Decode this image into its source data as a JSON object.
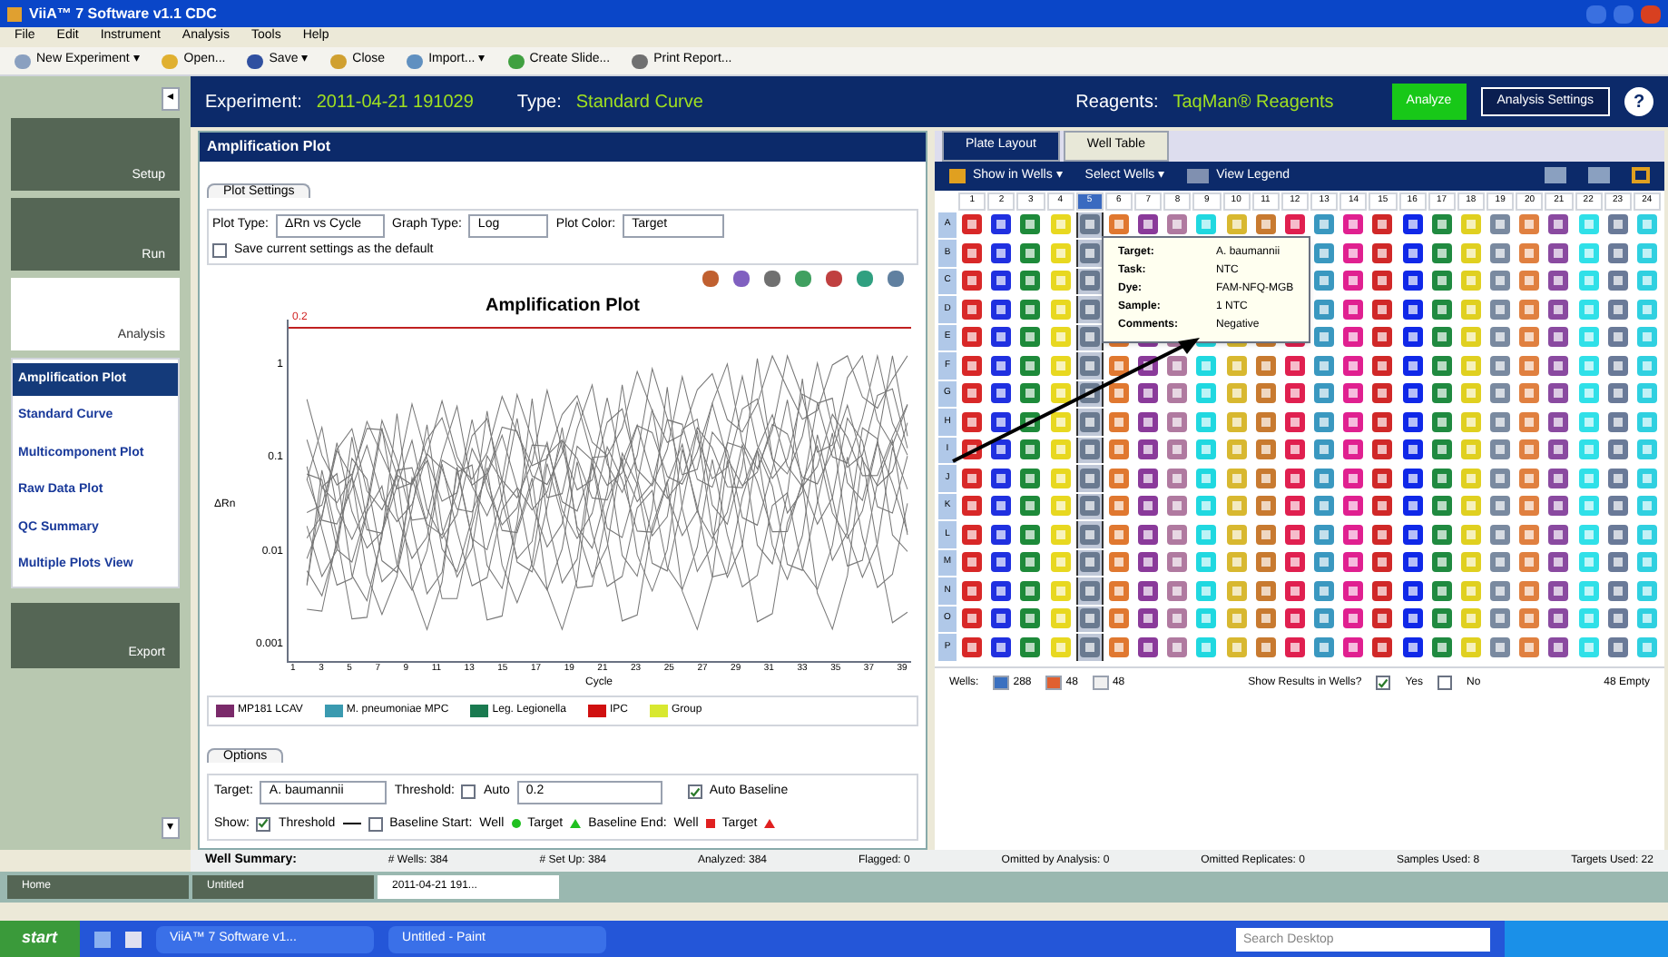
{
  "window": {
    "title": "ViiA™ 7 Software v1.1 CDC"
  },
  "menu": [
    "File",
    "Edit",
    "Instrument",
    "Analysis",
    "Tools",
    "Help"
  ],
  "toolbar": [
    {
      "label": "New Experiment ▾",
      "kind": "new"
    },
    {
      "label": "Open...",
      "kind": "open"
    },
    {
      "label": "Save ▾",
      "kind": "save"
    },
    {
      "label": "Close",
      "kind": "close"
    },
    {
      "label": "Import... ▾",
      "kind": "import"
    },
    {
      "label": "Create Slide...",
      "kind": "slide"
    },
    {
      "label": "Print Report...",
      "kind": "print"
    }
  ],
  "header": {
    "experiment_label": "Experiment:",
    "experiment": "2011-04-21 191029",
    "type_label": "Type:",
    "type": "Standard Curve",
    "reagents_label": "Reagents:",
    "reagents": "TaqMan® Reagents",
    "analyze": "Analyze",
    "settings": "Analysis Settings",
    "help": "?"
  },
  "sidebar": {
    "collapse": "◂",
    "sections": [
      {
        "label": "Setup",
        "kind": "setup"
      },
      {
        "label": "Run",
        "kind": "run"
      },
      {
        "label": "Analysis",
        "kind": "analysis"
      }
    ],
    "items": [
      {
        "label": "Amplification Plot",
        "selected": true
      },
      {
        "label": "Standard Curve",
        "selected": false
      },
      {
        "label": "Multicomponent Plot",
        "selected": false
      },
      {
        "label": "Raw Data Plot",
        "selected": false
      },
      {
        "label": "QC Summary",
        "selected": false
      },
      {
        "label": "Multiple Plots View",
        "selected": false
      }
    ],
    "export": "Export",
    "bottom_button": "▾"
  },
  "amplification": {
    "title": "Amplification Plot",
    "settings_tab": "Plot Settings",
    "plot_type_label": "Plot Type:",
    "plot_type": "ΔRn vs Cycle",
    "graph_type_label": "Graph Type:",
    "graph_type": "Log",
    "plot_color_label": "Plot Color:",
    "plot_color": "Target",
    "save_default": {
      "label": "Save current settings as the default",
      "checked": false
    },
    "chart": {
      "title": "Amplification Plot",
      "threshold": "0.2",
      "ylabel": "ΔRn",
      "xlabel": "Cycle",
      "y_tick_labels": [
        "1",
        "0.1",
        "0.01",
        "0.001"
      ],
      "x_tick_labels": [
        "1",
        "3",
        "5",
        "7",
        "9",
        "11",
        "13",
        "15",
        "17",
        "19",
        "21",
        "23",
        "25",
        "27",
        "29",
        "31",
        "33",
        "35",
        "37",
        "39"
      ]
    },
    "legend": [
      {
        "label": "MP181 LCAV",
        "color": "#7a2a6a"
      },
      {
        "label": "M. pneumoniae MPC",
        "color": "#3a9ab0"
      },
      {
        "label": "Leg. Legionella",
        "color": "#1a7a50"
      },
      {
        "label": "IPC",
        "color": "#d01010"
      },
      {
        "label": "Group",
        "color": "#d8e830"
      }
    ],
    "options_tab": "Options",
    "target_label": "Target:",
    "target": "A. baumannii",
    "threshold_label": "Threshold:",
    "auto_threshold": {
      "label": "Auto",
      "checked": false
    },
    "threshold": "0.2",
    "auto_baseline": {
      "label": "Auto Baseline",
      "checked": true
    },
    "show_label": "Show:",
    "show_threshold": {
      "label": "Threshold",
      "checked": true
    },
    "baseline_start": {
      "label": "Baseline Start:",
      "checked": false
    },
    "start_well": "Well",
    "start_target": "Target",
    "baseline_end": "Baseline End:",
    "end_well": "Well",
    "end_target": "Target"
  },
  "plate": {
    "tabs": [
      {
        "label": "Plate Layout",
        "selected": true
      },
      {
        "label": "Well Table",
        "selected": false
      }
    ],
    "show_in_wells": "Show in Wells ▾",
    "select_wells": "Select Wells ▾",
    "view_legend": "View Legend",
    "rows": [
      "A",
      "B",
      "C",
      "D",
      "E",
      "F",
      "G",
      "H",
      "I",
      "J",
      "K",
      "L",
      "M",
      "N",
      "O",
      "P"
    ],
    "columns": [
      {
        "label": "1",
        "color": "#d82828",
        "selected": false
      },
      {
        "label": "2",
        "color": "#2030e0",
        "selected": false
      },
      {
        "label": "3",
        "color": "#1e8a3a",
        "selected": false
      },
      {
        "label": "4",
        "color": "#e8d820",
        "selected": false
      },
      {
        "label": "5",
        "color": "#6a7a90",
        "selected": true
      },
      {
        "label": "6",
        "color": "#e07830",
        "selected": false
      },
      {
        "label": "7",
        "color": "#8a3a9a",
        "selected": false
      },
      {
        "label": "8",
        "color": "#b07aa0",
        "selected": false
      },
      {
        "label": "9",
        "color": "#20d8e0",
        "selected": false
      },
      {
        "label": "10",
        "color": "#d8b830",
        "selected": false
      },
      {
        "label": "11",
        "color": "#c87a30",
        "selected": false
      },
      {
        "label": "12",
        "color": "#e02050",
        "selected": false
      },
      {
        "label": "13",
        "color": "#3a98c0",
        "selected": false
      },
      {
        "label": "14",
        "color": "#e02090",
        "selected": false
      },
      {
        "label": "15",
        "color": "#d02828",
        "selected": false
      },
      {
        "label": "16",
        "color": "#1028e8",
        "selected": false
      },
      {
        "label": "17",
        "color": "#208a40",
        "selected": false
      },
      {
        "label": "18",
        "color": "#e0d020",
        "selected": false
      },
      {
        "label": "19",
        "color": "#7a8aa0",
        "selected": false
      },
      {
        "label": "20",
        "color": "#e08040",
        "selected": false
      },
      {
        "label": "21",
        "color": "#8a4aa0",
        "selected": false
      },
      {
        "label": "22",
        "color": "#30e0e8",
        "selected": false
      },
      {
        "label": "23",
        "color": "#6a7a98",
        "selected": false
      },
      {
        "label": "24",
        "color": "#30d0e0",
        "selected": false
      }
    ],
    "tooltip": [
      {
        "label": "Target:",
        "value": "A. baumannii"
      },
      {
        "label": "Task:",
        "value": "NTC"
      },
      {
        "label": "Dye:",
        "value": "FAM-NFQ-MGB"
      },
      {
        "label": "Sample:",
        "value": "1 NTC"
      },
      {
        "label": "Comments:",
        "value": "Negative"
      }
    ],
    "wells_label": "Wells:",
    "counts": [
      {
        "label": "288",
        "color": "#3a70c0"
      },
      {
        "label": "48",
        "color": "#e06030"
      },
      {
        "label": "48",
        "color": "#f0f0f0"
      }
    ],
    "show_results": "Show Results in Wells?",
    "yes": {
      "label": "Yes",
      "checked": true
    },
    "no": {
      "label": "No",
      "checked": false
    },
    "empty": "48 Empty"
  },
  "well_summary": {
    "label": "Well Summary:",
    "items": [
      "# Wells: 384",
      "# Set Up: 384",
      "Analyzed: 384",
      "Flagged: 0",
      "Omitted by Analysis: 0",
      "Omitted Replicates: 0",
      "Samples Used: 8",
      "Targets Used: 22"
    ]
  },
  "doc_tabs": [
    {
      "label": "Home",
      "selected": false
    },
    {
      "label": "Untitled",
      "selected": false
    },
    {
      "label": "2011-04-21 191...",
      "selected": true
    }
  ],
  "taskbar": {
    "start": "start",
    "items": [
      "ViiA™ 7 Software v1...",
      "Untitled - Paint"
    ],
    "search_placeholder": "Search Desktop"
  }
}
